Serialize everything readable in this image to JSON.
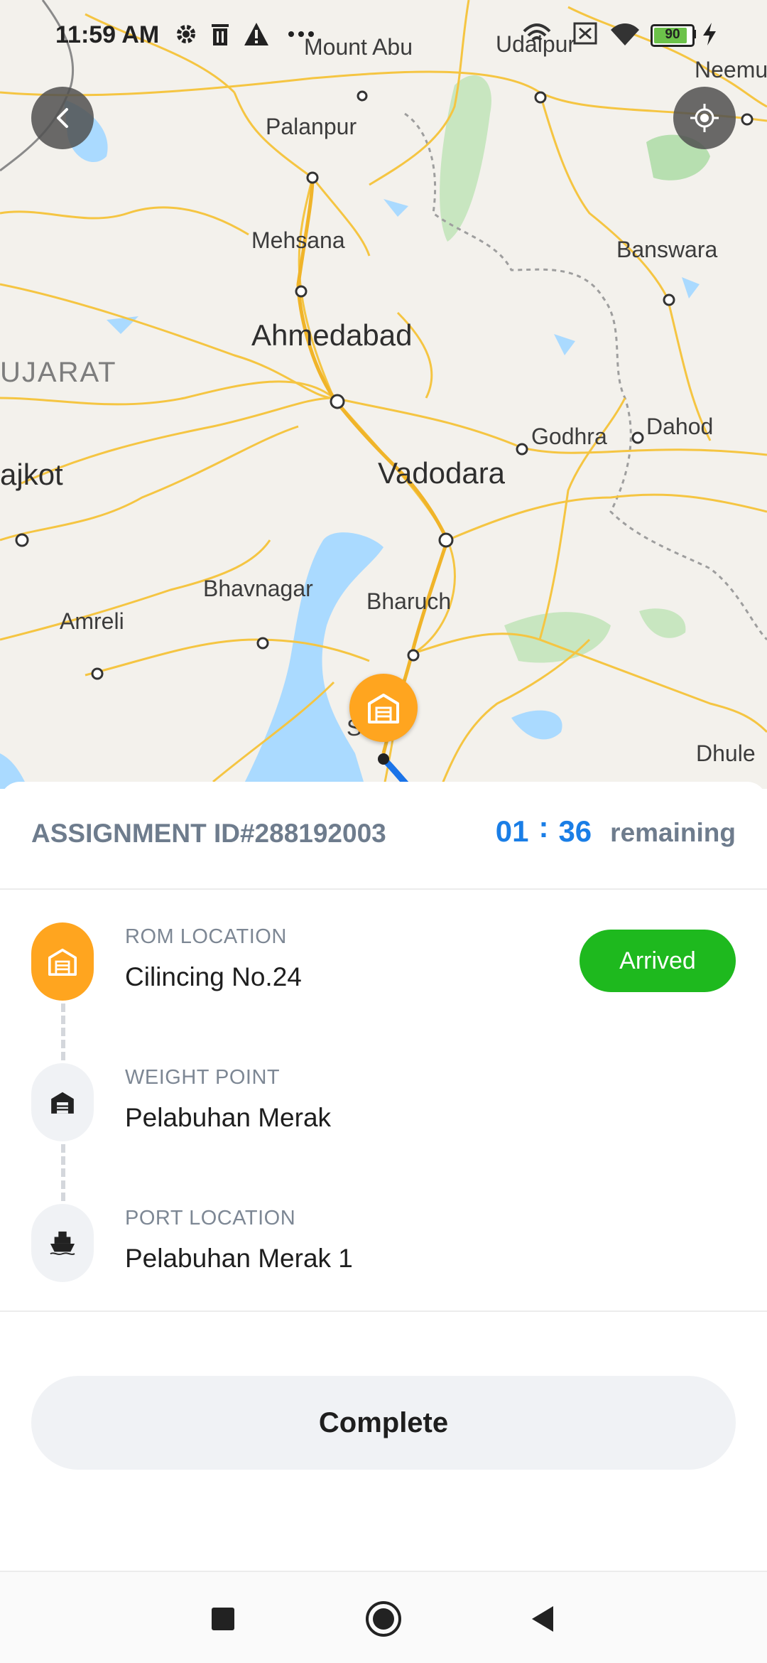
{
  "status_bar": {
    "time": "11:59 AM",
    "battery": "90",
    "icons": [
      "gear-icon",
      "trash-icon",
      "warning-icon",
      "more-dots-icon",
      "wifi-calling-icon",
      "sim-off-icon",
      "wifi-icon",
      "battery-icon",
      "charging-icon"
    ]
  },
  "map": {
    "cities": {
      "mount_abu": "Mount Abu",
      "udaipur": "Udaipur",
      "neemuch": "Neemu",
      "palanpur": "Palanpur",
      "mehsana": "Mehsana",
      "banswara": "Banswara",
      "ahmedabad": "Ahmedabad",
      "gujarat": "UJARAT",
      "godhra": "Godhra",
      "dahod": "Dahod",
      "rajkot": "ajkot",
      "vadodara": "Vadodara",
      "bhavnagar": "Bhavnagar",
      "bharuch": "Bharuch",
      "amreli": "Amreli",
      "surat": "Surat",
      "dhule": "Dhule"
    },
    "marker_icon": "warehouse-icon",
    "colors": {
      "road": "#f5c542",
      "water": "#aadaff",
      "park": "#c8e6c0",
      "route": "#1a73e8",
      "marker": "#ffa51f"
    }
  },
  "controls": {
    "back_icon": "back-arrow-icon",
    "locate_icon": "locate-me-icon"
  },
  "assignment": {
    "id_label": "ASSIGNMENT ID#288192003",
    "timer_hours": "01",
    "timer_sep": ":",
    "timer_minutes": "36",
    "timer_suffix": "remaining"
  },
  "stops": [
    {
      "caption": "ROM LOCATION",
      "value": "Cilincing No.24",
      "icon": "warehouse-icon",
      "status": "Arrived"
    },
    {
      "caption": "WEIGHT POINT",
      "value": "Pelabuhan Merak",
      "icon": "weighbridge-icon"
    },
    {
      "caption": "PORT LOCATION",
      "value": "Pelabuhan Merak 1",
      "icon": "ship-icon"
    }
  ],
  "actions": {
    "complete": "Complete"
  },
  "nav": {
    "icons": [
      "recents-square-icon",
      "home-circle-icon",
      "back-triangle-icon"
    ]
  },
  "colors": {
    "accent": "#1a7ee6",
    "arrived": "#1eb91e",
    "active_stop": "#ffa51f",
    "muted": "#6e7c8d"
  }
}
